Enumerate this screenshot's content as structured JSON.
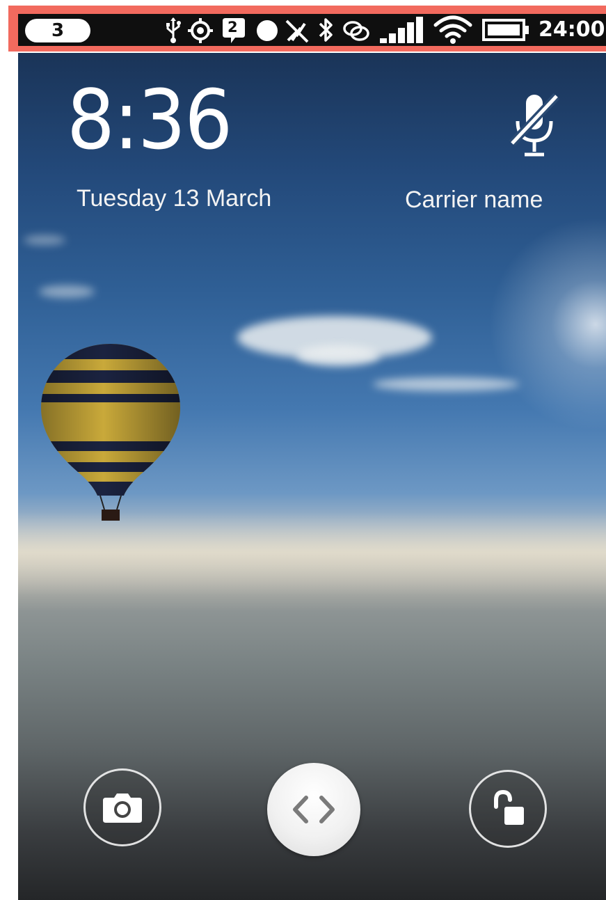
{
  "status_bar": {
    "notification_count": "3",
    "message_count": "2",
    "time": "24:00",
    "icons": [
      "usb-icon",
      "location-icon",
      "message-icon",
      "record-icon",
      "no-sim-icon",
      "bluetooth-icon",
      "sync-icon",
      "signal-icon",
      "wifi-icon",
      "battery-icon"
    ],
    "frame_color": "#f26a5e"
  },
  "lockscreen": {
    "clock": "8:36",
    "date": "Tuesday 13 March",
    "carrier": "Carrier name",
    "mute_icon": "mic-muted-icon"
  },
  "actions": {
    "camera_icon": "camera-icon",
    "handle_icon": "chevron-left-right-icon",
    "unlock_icon": "unlock-icon"
  }
}
